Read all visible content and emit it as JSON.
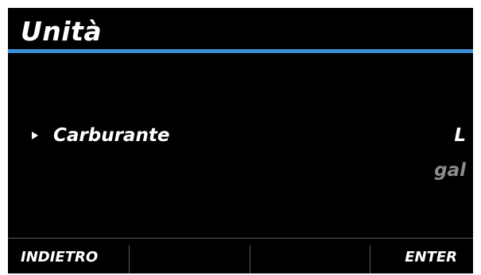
{
  "header": {
    "title": "Unità",
    "accent_color": "#3b8fd9"
  },
  "setting": {
    "label": "Carburante",
    "pointer_icon": "triangle-right-icon",
    "options": [
      "L",
      "gal"
    ],
    "selected_option": "L"
  },
  "softkeys": {
    "key1": "INDIETRO",
    "key2": "",
    "key3": "",
    "key4": "ENTER"
  }
}
